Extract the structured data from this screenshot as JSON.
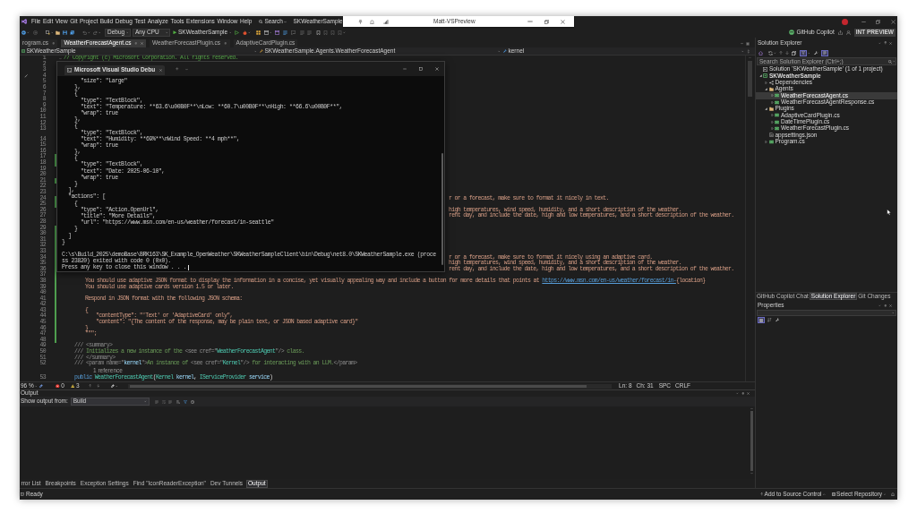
{
  "remote_session_bar": {
    "title": "Matt-VSPreview"
  },
  "menu_bar": {
    "items": [
      "File",
      "Edit",
      "View",
      "Git",
      "Project",
      "Build",
      "Debug",
      "Test",
      "Analyze",
      "Tools",
      "Extensions",
      "Window",
      "Help"
    ],
    "search": "Search",
    "solution_name": "SKWeatherSample"
  },
  "toolbar": {
    "configuration": "Debug",
    "platform": "Any CPU",
    "start_target": "SKWeatherSample",
    "copilot": "GitHub Copilot",
    "preview_badge": "INT PREVIEW"
  },
  "document_tabs": [
    {
      "label": "rogram.cs",
      "selected": false,
      "pinned": true
    },
    {
      "label": "WeatherForecastAgent.cs",
      "selected": true,
      "pinned": true
    },
    {
      "label": "WeatherForecastPlugin.cs",
      "selected": false,
      "pinned": true
    },
    {
      "label": "AdaptiveCardPlugin.cs",
      "selected": false,
      "pinned": false
    }
  ],
  "navigation_bar": {
    "project": "SKWeatherSample",
    "type": "SKWeatherSample.Agents.WeatherForecastAgent",
    "member": "kernel"
  },
  "editor": {
    "lines": [
      {
        "number": "1",
        "changed": false,
        "expanded": true,
        "segments": [
          {
            "kind": "comment",
            "text": "// Copyright (c) Microsoft Corporation. All rights reserved."
          }
        ]
      },
      {
        "number": "2",
        "changed": false
      },
      {
        "number": "3",
        "changed": false
      },
      {
        "number": "4",
        "changed": false
      },
      {
        "number": "5",
        "changed": false
      },
      {
        "number": "6",
        "changed": false
      },
      {
        "number": "7",
        "changed": false
      },
      {
        "number": "8",
        "changed": false
      },
      {
        "number": "9",
        "changed": false
      },
      {
        "number": "10",
        "changed": false
      },
      {
        "number": "11",
        "changed": false
      },
      {
        "number": "12",
        "changed": false
      },
      {
        "number": "13",
        "changed": false
      },
      {
        "number": "14",
        "changed": false
      },
      {
        "number": "15",
        "changed": false
      },
      {
        "number": "16",
        "changed": false
      },
      {
        "number": "17",
        "changed": true
      },
      {
        "number": "18",
        "changed": true
      },
      {
        "number": "19",
        "changed": false
      },
      {
        "number": "20",
        "changed": false
      },
      {
        "number": "21",
        "changed": true
      },
      {
        "number": "22",
        "changed": false
      },
      {
        "number": "23",
        "changed": false
      },
      {
        "number": "24",
        "changed": true,
        "segments": [
          {
            "kind": "string",
            "text": "r or a forecast, make sure to format it nicely in text."
          }
        ]
      },
      {
        "number": "25",
        "changed": true
      },
      {
        "number": "26",
        "changed": false,
        "segments": [
          {
            "kind": "string",
            "text": "high temperatures, wind speed, humidity, and a short description of the weather."
          }
        ]
      },
      {
        "number": "27",
        "changed": false,
        "segments": [
          {
            "kind": "string",
            "text": "rent day, and include the date, high and low temperatures, and a short description of the weather."
          }
        ]
      },
      {
        "number": "28",
        "changed": false
      },
      {
        "number": "29",
        "changed": true
      },
      {
        "number": "30",
        "changed": true
      },
      {
        "number": "31",
        "changed": true
      },
      {
        "number": "32",
        "changed": true
      },
      {
        "number": "33",
        "changed": true
      },
      {
        "number": "34",
        "changed": true,
        "segments": [
          {
            "kind": "string",
            "text": "r or a forecast, make sure to format it nicely using an adaptive card."
          }
        ]
      },
      {
        "number": "35",
        "changed": true,
        "segments": [
          {
            "kind": "string",
            "text": "high temperatures, wind speed, humidity, and a short description of the weather."
          }
        ]
      },
      {
        "number": "36",
        "changed": true,
        "segments": [
          {
            "kind": "string",
            "text": "rent day, and include the date, high and low temperatures, and a short description of the weather."
          }
        ]
      },
      {
        "number": "37",
        "changed": true
      },
      {
        "number": "38",
        "changed": true,
        "segments": [
          {
            "kind": "string",
            "text": "        You should use adaptive JSON format to display the information in a concise, yet visually appealing way and include a button for more details that points at "
          },
          {
            "kind": "link",
            "text": "https://www.msn.com/en-us/weather/forecast/in-"
          },
          {
            "kind": "string",
            "text": "{location}"
          }
        ]
      },
      {
        "number": "39",
        "changed": true,
        "segments": [
          {
            "kind": "string",
            "text": "        You should use adaptive cards version 1.5 or later."
          }
        ]
      },
      {
        "number": "40",
        "changed": true
      },
      {
        "number": "41",
        "changed": true,
        "segments": [
          {
            "kind": "string",
            "text": "        Respond in JSON format with the following JSON schema:"
          }
        ]
      },
      {
        "number": "42",
        "changed": true
      },
      {
        "number": "43",
        "changed": true,
        "segments": [
          {
            "kind": "string",
            "text": "        {"
          }
        ]
      },
      {
        "number": "44",
        "changed": true,
        "segments": [
          {
            "kind": "string",
            "text": "            \"contentType\": \"'Text' or 'AdaptiveCard' only\","
          }
        ]
      },
      {
        "number": "45",
        "changed": true,
        "segments": [
          {
            "kind": "string",
            "text": "            \"content\": \"{The content of the response, may be plain text, or JSON based adaptive card}\""
          }
        ]
      },
      {
        "number": "46",
        "changed": true,
        "segments": [
          {
            "kind": "string",
            "text": "        }"
          }
        ]
      },
      {
        "number": "47",
        "changed": true,
        "segments": [
          {
            "kind": "string",
            "text": "        \"\"\";"
          }
        ]
      },
      {
        "number": "48",
        "changed": true
      },
      {
        "number": "49",
        "changed": false,
        "segments": [
          {
            "kind": "doc_tag",
            "text": "    /// <summary>"
          }
        ]
      },
      {
        "number": "50",
        "changed": false,
        "segments": [
          {
            "kind": "doc_tag",
            "text": "    /// "
          },
          {
            "kind": "doc",
            "text": "Initializes a new instance of the "
          },
          {
            "kind": "doc_tag",
            "text": "<see cref=\""
          },
          {
            "kind": "type",
            "text": "WeatherForecastAgent"
          },
          {
            "kind": "doc_tag",
            "text": "\"/>"
          },
          {
            "kind": "doc",
            "text": " class."
          }
        ]
      },
      {
        "number": "51",
        "changed": false,
        "segments": [
          {
            "kind": "doc_tag",
            "text": "    /// </summary>"
          }
        ]
      },
      {
        "number": "52",
        "changed": false,
        "segments": [
          {
            "kind": "doc_tag",
            "text": "    /// <param name=\""
          },
          {
            "kind": "param",
            "text": "kernel"
          },
          {
            "kind": "doc_tag",
            "text": "\">"
          },
          {
            "kind": "doc",
            "text": "An instance of "
          },
          {
            "kind": "doc_tag",
            "text": "<see cref=\""
          },
          {
            "kind": "type",
            "text": "Kernel"
          },
          {
            "kind": "doc_tag",
            "text": "\"/>"
          },
          {
            "kind": "doc",
            "text": " for interacting with an LLM."
          },
          {
            "kind": "doc_tag",
            "text": "</param>"
          }
        ]
      },
      {
        "number": "53",
        "changed": false,
        "codelens": "1 reference",
        "segments": [
          {
            "kind": "keyword",
            "text": "    public"
          },
          {
            "kind": "type",
            "text": " WeatherForecastAgent"
          },
          {
            "kind": "plain",
            "text": "("
          },
          {
            "kind": "type",
            "text": "Kernel"
          },
          {
            "kind": "param",
            "text": " kernel"
          },
          {
            "kind": "plain",
            "text": ", "
          },
          {
            "kind": "type",
            "text": "IServiceProvider"
          },
          {
            "kind": "param",
            "text": " service"
          },
          {
            "kind": "plain",
            "text": ")"
          }
        ]
      }
    ]
  },
  "editor_status": {
    "zoom": "96 %",
    "errors": "0",
    "warnings": "3",
    "line": "Ln: 8",
    "column": "Ch: 31",
    "indentation": "SPC",
    "line_ending": "CRLF"
  },
  "console_window": {
    "tab_title": "Microsoft Visual Studio Debu",
    "json_lines": [
      "      \"size\": \"Large\"",
      "    },",
      "    {",
      "      \"type\": \"TextBlock\",",
      "      \"text\": \"Temperature: **63.6\\u00B0F**\\nLow: **60.7\\u00B0F**\\nHigh: **66.6\\u00B0F**\",",
      "      \"wrap\": true",
      "    },",
      "    {",
      "      \"type\": \"TextBlock\",",
      "      \"text\": \"Humidity: **69%**\\nWind Speed: **4 mph**\",",
      "      \"wrap\": true",
      "    },",
      "    {",
      "      \"type\": \"TextBlock\",",
      "      \"text\": \"Date: 2025-06-10\",",
      "      \"wrap\": true",
      "    }",
      "  ],",
      "  \"actions\": [",
      "    {",
      "      \"type\": \"Action.OpenUrl\",",
      "      \"title\": \"More Details\",",
      "      \"url\": \"https://www.msn.com/en-us/weather/forecast/in-seattle\"",
      "    }",
      "  ]",
      "}"
    ],
    "exit_lines": [
      "C:\\s\\Build_2025\\demoBase\\BRK163\\SK_Example_OpenWeather\\SKWeatherSampleClient\\bin\\Debug\\net8.0\\SKWeatherSample.exe (proce",
      "ss 23820) exited with code 0 (0x0).",
      "Press any key to close this window . . ."
    ]
  },
  "output_panel": {
    "title": "Output",
    "source_label": "Show output from:",
    "source": "Build"
  },
  "bottom_tabs": [
    {
      "label": "rror List",
      "selected": false
    },
    {
      "label": "Breakpoints",
      "selected": false
    },
    {
      "label": "Exception Settings",
      "selected": false
    },
    {
      "label": "Find \"IconReaderException\"",
      "selected": false
    },
    {
      "label": "Dev Tunnels",
      "selected": false
    },
    {
      "label": "Output",
      "selected": true
    }
  ],
  "solution_explorer": {
    "title": "Solution Explorer",
    "search": {
      "placeholder": "Search Solution Explorer (Ctrl+;)"
    },
    "tree": [
      {
        "label": "Solution 'SKWeatherSample' (1 of 1 project)",
        "kind": "solution",
        "selected": false,
        "children": [
          {
            "label": "SKWeatherSample",
            "kind": "project",
            "expanded": true,
            "selected": false,
            "children": [
              {
                "label": "Dependencies",
                "kind": "dependencies",
                "expanded": false,
                "selected": false
              },
              {
                "label": "Agents",
                "kind": "folder",
                "expanded": true,
                "selected": false,
                "children": [
                  {
                    "label": "WeatherForecastAgent.cs",
                    "kind": "csharp",
                    "expanded": false,
                    "selected": true
                  },
                  {
                    "label": "WeatherForecastAgentResponse.cs",
                    "kind": "csharp",
                    "expanded": false,
                    "selected": false
                  }
                ]
              },
              {
                "label": "Plugins",
                "kind": "folder",
                "expanded": true,
                "selected": false,
                "children": [
                  {
                    "label": "AdaptiveCardPlugin.cs",
                    "kind": "csharp",
                    "expanded": false,
                    "selected": false
                  },
                  {
                    "label": "DateTimePlugin.cs",
                    "kind": "csharp",
                    "expanded": false,
                    "selected": false
                  },
                  {
                    "label": "WeatherForecastPlugin.cs",
                    "kind": "csharp",
                    "expanded": false,
                    "selected": false
                  }
                ]
              },
              {
                "label": "appsettings.json",
                "kind": "json",
                "selected": false
              },
              {
                "label": "Program.cs",
                "kind": "csharp",
                "expanded": false,
                "selected": false
              }
            ]
          }
        ]
      }
    ]
  },
  "side_tabs": [
    {
      "label": "GitHub Copilot Chat",
      "selected": false
    },
    {
      "label": "Solution Explorer",
      "selected": true
    },
    {
      "label": "Git Changes",
      "selected": false
    }
  ],
  "properties_panel": {
    "title": "Properties"
  },
  "status_bar": {
    "text": "Ready",
    "source_control": "Add to Source Control",
    "repository": "Select Repository"
  }
}
